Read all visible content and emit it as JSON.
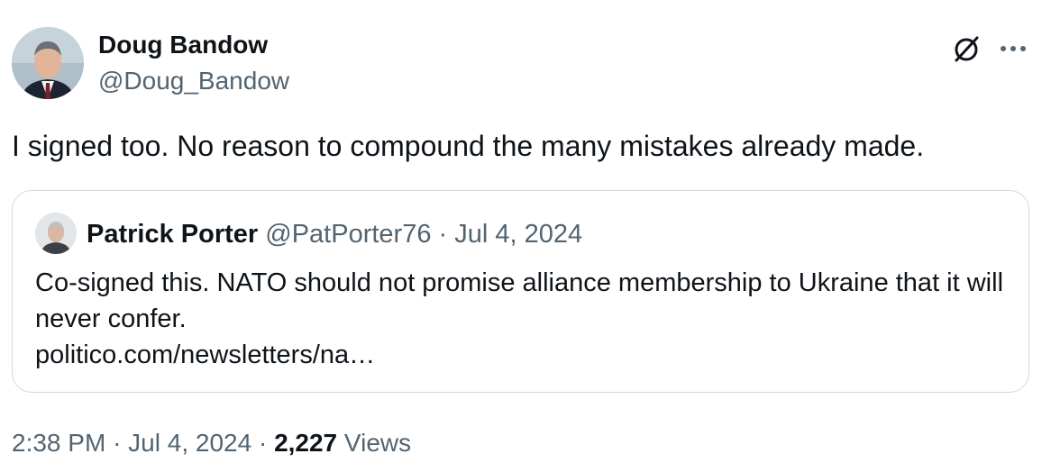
{
  "author": {
    "name": "Doug Bandow",
    "handle": "@Doug_Bandow"
  },
  "icons": {
    "grok": "grok-icon",
    "more": "more-dots-icon"
  },
  "tweet": {
    "text": "I signed too. No reason to compound the many mistakes already made."
  },
  "quote": {
    "name": "Patrick Porter",
    "handle": "@PatPorter76",
    "separator": "·",
    "date": "Jul 4, 2024",
    "body": "Co-signed this. NATO should not promise alliance membership to Ukraine that it will never confer.",
    "link": "politico.com/newsletters/na…"
  },
  "footer": {
    "time": "2:38 PM",
    "sep1": "·",
    "date": "Jul 4, 2024",
    "sep2": "·",
    "views_count": "2,227",
    "views_label": "Views"
  },
  "colors": {
    "text": "#0f1419",
    "secondary": "#536471",
    "border": "#cfd9de"
  }
}
